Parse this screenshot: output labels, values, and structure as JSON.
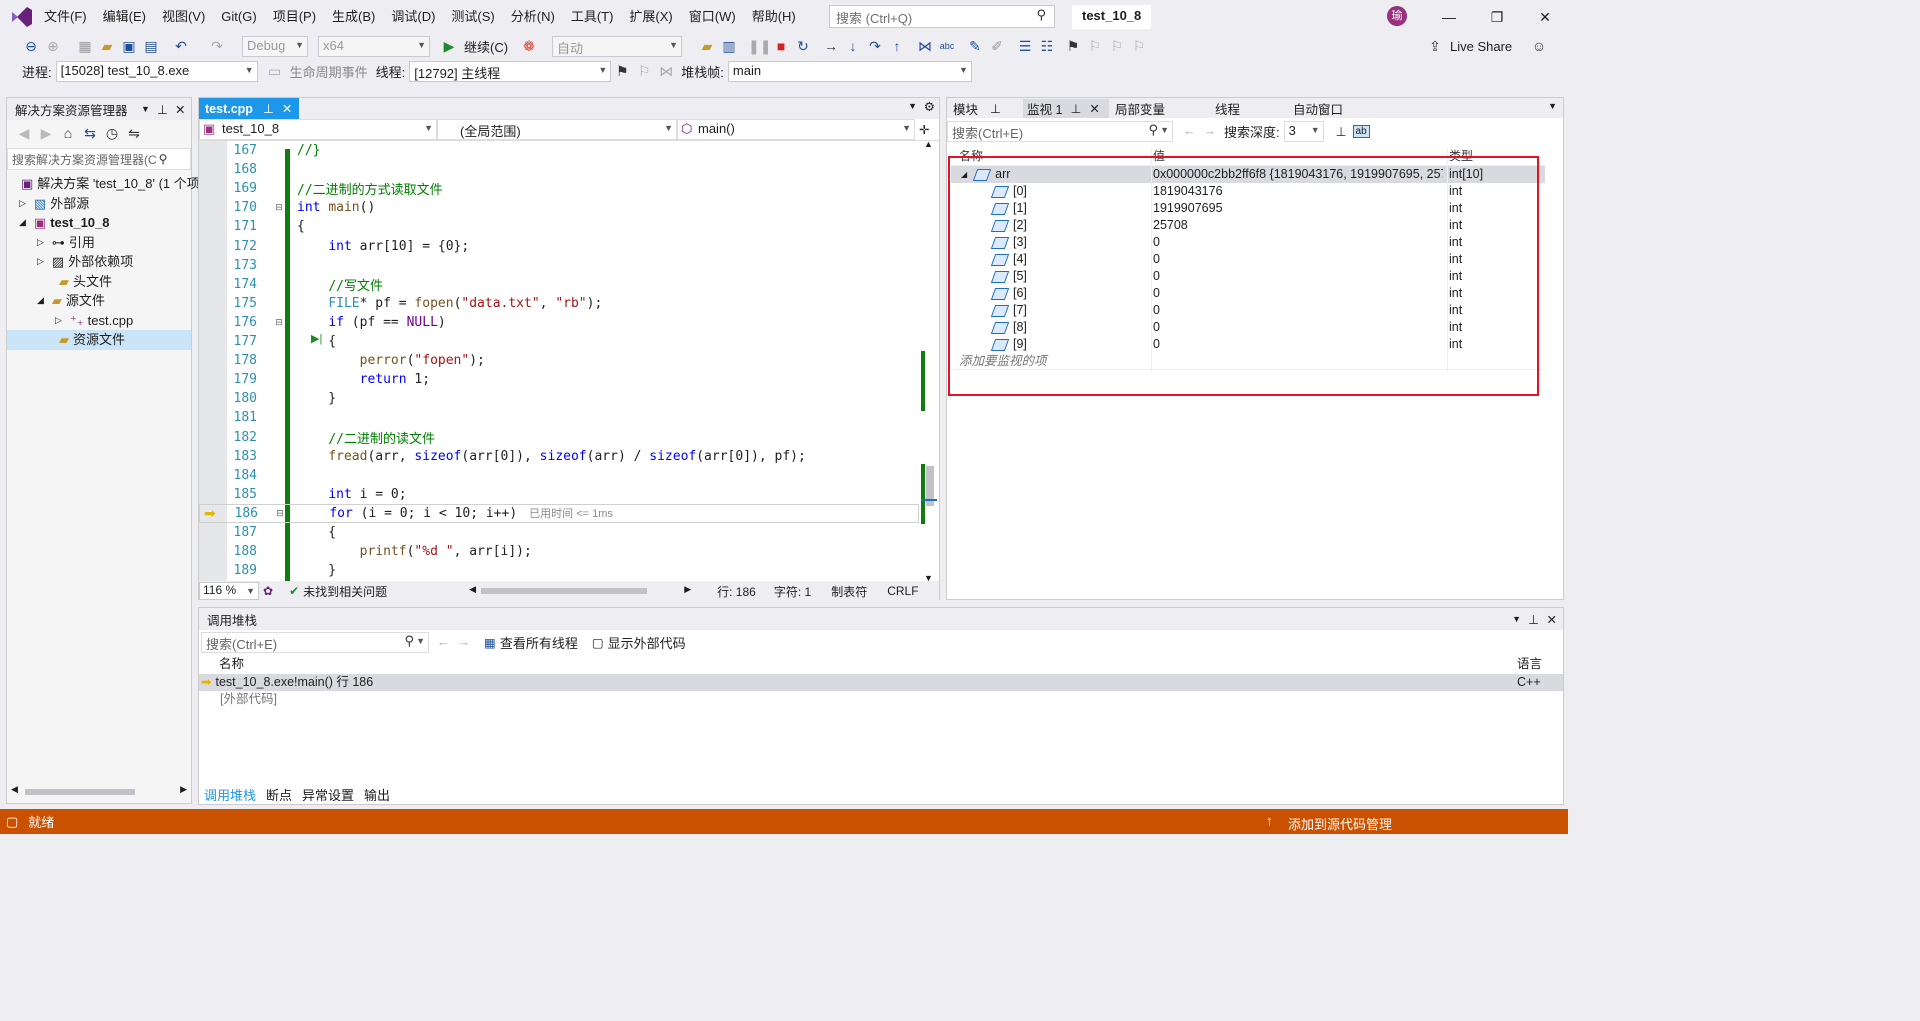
{
  "menu": {
    "items": [
      "文件(F)",
      "编辑(E)",
      "视图(V)",
      "Git(G)",
      "项目(P)",
      "生成(B)",
      "调试(D)",
      "测试(S)",
      "分析(N)",
      "工具(T)",
      "扩展(X)",
      "窗口(W)",
      "帮助(H)"
    ],
    "search_placeholder": "搜索 (Ctrl+Q)",
    "solution_name": "test_10_8",
    "avatar_initial": "瑜",
    "live_share": "Live Share"
  },
  "toolbar": {
    "config": "Debug",
    "platform": "x64",
    "continue_label": "继续(C)",
    "auto_label": "自动"
  },
  "debug_bar": {
    "process_label": "进程:",
    "process_value": "[15028] test_10_8.exe",
    "lifecycle_label": "生命周期事件",
    "thread_label": "线程:",
    "thread_value": "[12792] 主线程",
    "stackframe_label": "堆栈帧:",
    "stackframe_value": "main"
  },
  "solution_explorer": {
    "title": "解决方案资源管理器",
    "search_placeholder": "搜索解决方案资源管理器(C",
    "items": [
      {
        "label": "解决方案 'test_10_8' (1 个项",
        "bold": false
      },
      {
        "label": "外部源",
        "bold": false
      },
      {
        "label": "test_10_8",
        "bold": true
      },
      {
        "label": "引用",
        "bold": false
      },
      {
        "label": "外部依赖项",
        "bold": false
      },
      {
        "label": "头文件",
        "bold": false
      },
      {
        "label": "源文件",
        "bold": false
      },
      {
        "label": "test.cpp",
        "bold": false
      },
      {
        "label": "资源文件",
        "bold": false
      }
    ]
  },
  "editor": {
    "tab_label": "test.cpp",
    "nav_project": "test_10_8",
    "nav_scope": "(全局范围)",
    "nav_function": "main()",
    "current_line": 186,
    "elapsed_hint": "已用时间 <= 1ms",
    "lines": [
      {
        "n": 167,
        "t": "//}"
      },
      {
        "n": 168,
        "t": ""
      },
      {
        "n": 169,
        "t": "//二进制的方式读取文件"
      },
      {
        "n": 170,
        "t": "int main()"
      },
      {
        "n": 171,
        "t": "{"
      },
      {
        "n": 172,
        "t": "    int arr[10] = {0};"
      },
      {
        "n": 173,
        "t": ""
      },
      {
        "n": 174,
        "t": "    //写文件"
      },
      {
        "n": 175,
        "t": "    FILE* pf = fopen(\"data.txt\", \"rb\");"
      },
      {
        "n": 176,
        "t": "    if (pf == NULL)"
      },
      {
        "n": 177,
        "t": "    {"
      },
      {
        "n": 178,
        "t": "        perror(\"fopen\");"
      },
      {
        "n": 179,
        "t": "        return 1;"
      },
      {
        "n": 180,
        "t": "    }"
      },
      {
        "n": 181,
        "t": ""
      },
      {
        "n": 182,
        "t": "    //二进制的读文件"
      },
      {
        "n": 183,
        "t": "    fread(arr, sizeof(arr[0]), sizeof(arr) / sizeof(arr[0]), pf);"
      },
      {
        "n": 184,
        "t": ""
      },
      {
        "n": 185,
        "t": "    int i = 0;"
      },
      {
        "n": 186,
        "t": "    for (i = 0; i < 10; i++)"
      },
      {
        "n": 187,
        "t": "    {"
      },
      {
        "n": 188,
        "t": "        printf(\"%d \", arr[i]);"
      },
      {
        "n": 189,
        "t": "    }"
      }
    ],
    "zoom": "116 %",
    "issues": "未找到相关问题",
    "line_label": "行: 186",
    "char_label": "字符: 1",
    "tab_mode": "制表符",
    "eol": "CRLF"
  },
  "watch": {
    "tabs": [
      "模块",
      "监视 1",
      "局部变量",
      "线程",
      "自动窗口"
    ],
    "search_placeholder": "搜索(Ctrl+E)",
    "depth_label": "搜索深度:",
    "depth_value": "3",
    "columns": [
      "名称",
      "值",
      "类型"
    ],
    "root": {
      "name": "arr",
      "value": "0x000000c2bb2ff6f8 {1819043176, 1919907695, 257...",
      "type": "int[10]"
    },
    "items": [
      {
        "name": "[0]",
        "value": "1819043176",
        "type": "int"
      },
      {
        "name": "[1]",
        "value": "1919907695",
        "type": "int"
      },
      {
        "name": "[2]",
        "value": "25708",
        "type": "int"
      },
      {
        "name": "[3]",
        "value": "0",
        "type": "int"
      },
      {
        "name": "[4]",
        "value": "0",
        "type": "int"
      },
      {
        "name": "[5]",
        "value": "0",
        "type": "int"
      },
      {
        "name": "[6]",
        "value": "0",
        "type": "int"
      },
      {
        "name": "[7]",
        "value": "0",
        "type": "int"
      },
      {
        "name": "[8]",
        "value": "0",
        "type": "int"
      },
      {
        "name": "[9]",
        "value": "0",
        "type": "int"
      }
    ],
    "add_hint": "添加要监视的项"
  },
  "callstack": {
    "title": "调用堆栈",
    "search_placeholder": "搜索(Ctrl+E)",
    "view_threads": "查看所有线程",
    "show_external": "显示外部代码",
    "col_name": "名称",
    "col_lang": "语言",
    "rows": [
      {
        "name": "test_10_8.exe!main() 行 186",
        "lang": "C++"
      },
      {
        "name": "[外部代码]",
        "lang": ""
      }
    ],
    "bottom_tabs": [
      "调用堆栈",
      "断点",
      "异常设置",
      "输出"
    ]
  },
  "status": {
    "ready": "就绪",
    "add_source": "添加到源代码管理"
  },
  "colors": {
    "accent": "#1c97ea",
    "status": "#ca5100",
    "highlight_box": "#e81123"
  }
}
